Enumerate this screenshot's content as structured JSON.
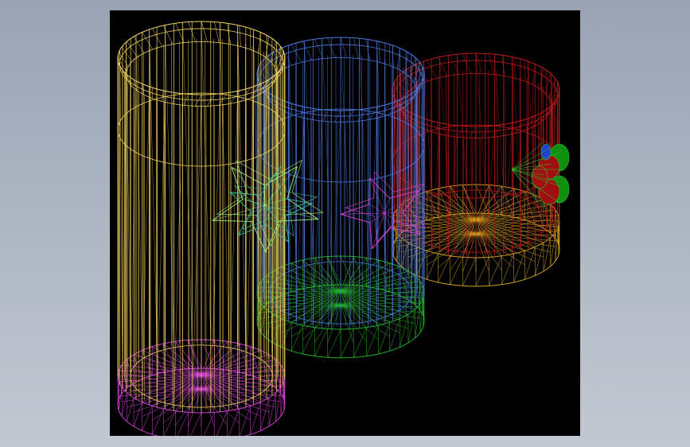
{
  "colors": {
    "background_top": "#99a3b3",
    "background_bottom": "#c2c8d2",
    "viewport": "#000000"
  },
  "scene": {
    "cylinders": [
      {
        "name": "yellow-cylinder",
        "body_color": "#f0d060",
        "base_color": "#d040d0",
        "rim_color": "#f0d060"
      },
      {
        "name": "blue-cylinder",
        "body_color": "#4a78e0",
        "base_color": "#20b020",
        "rim_color": "#4a78e0"
      },
      {
        "name": "red-cylinder",
        "body_color": "#c01818",
        "base_color": "#d0a020",
        "rim_color": "#c01818"
      }
    ],
    "stars": [
      {
        "name": "green-star",
        "color": "#a0f070"
      },
      {
        "name": "magenta-star",
        "color": "#e040e0"
      },
      {
        "name": "teal-star",
        "color": "#40c090"
      }
    ],
    "impellers": [
      {
        "name": "green-red-impeller",
        "primary": "#109010",
        "secondary": "#a01010",
        "accent": "#2040d0"
      }
    ]
  }
}
